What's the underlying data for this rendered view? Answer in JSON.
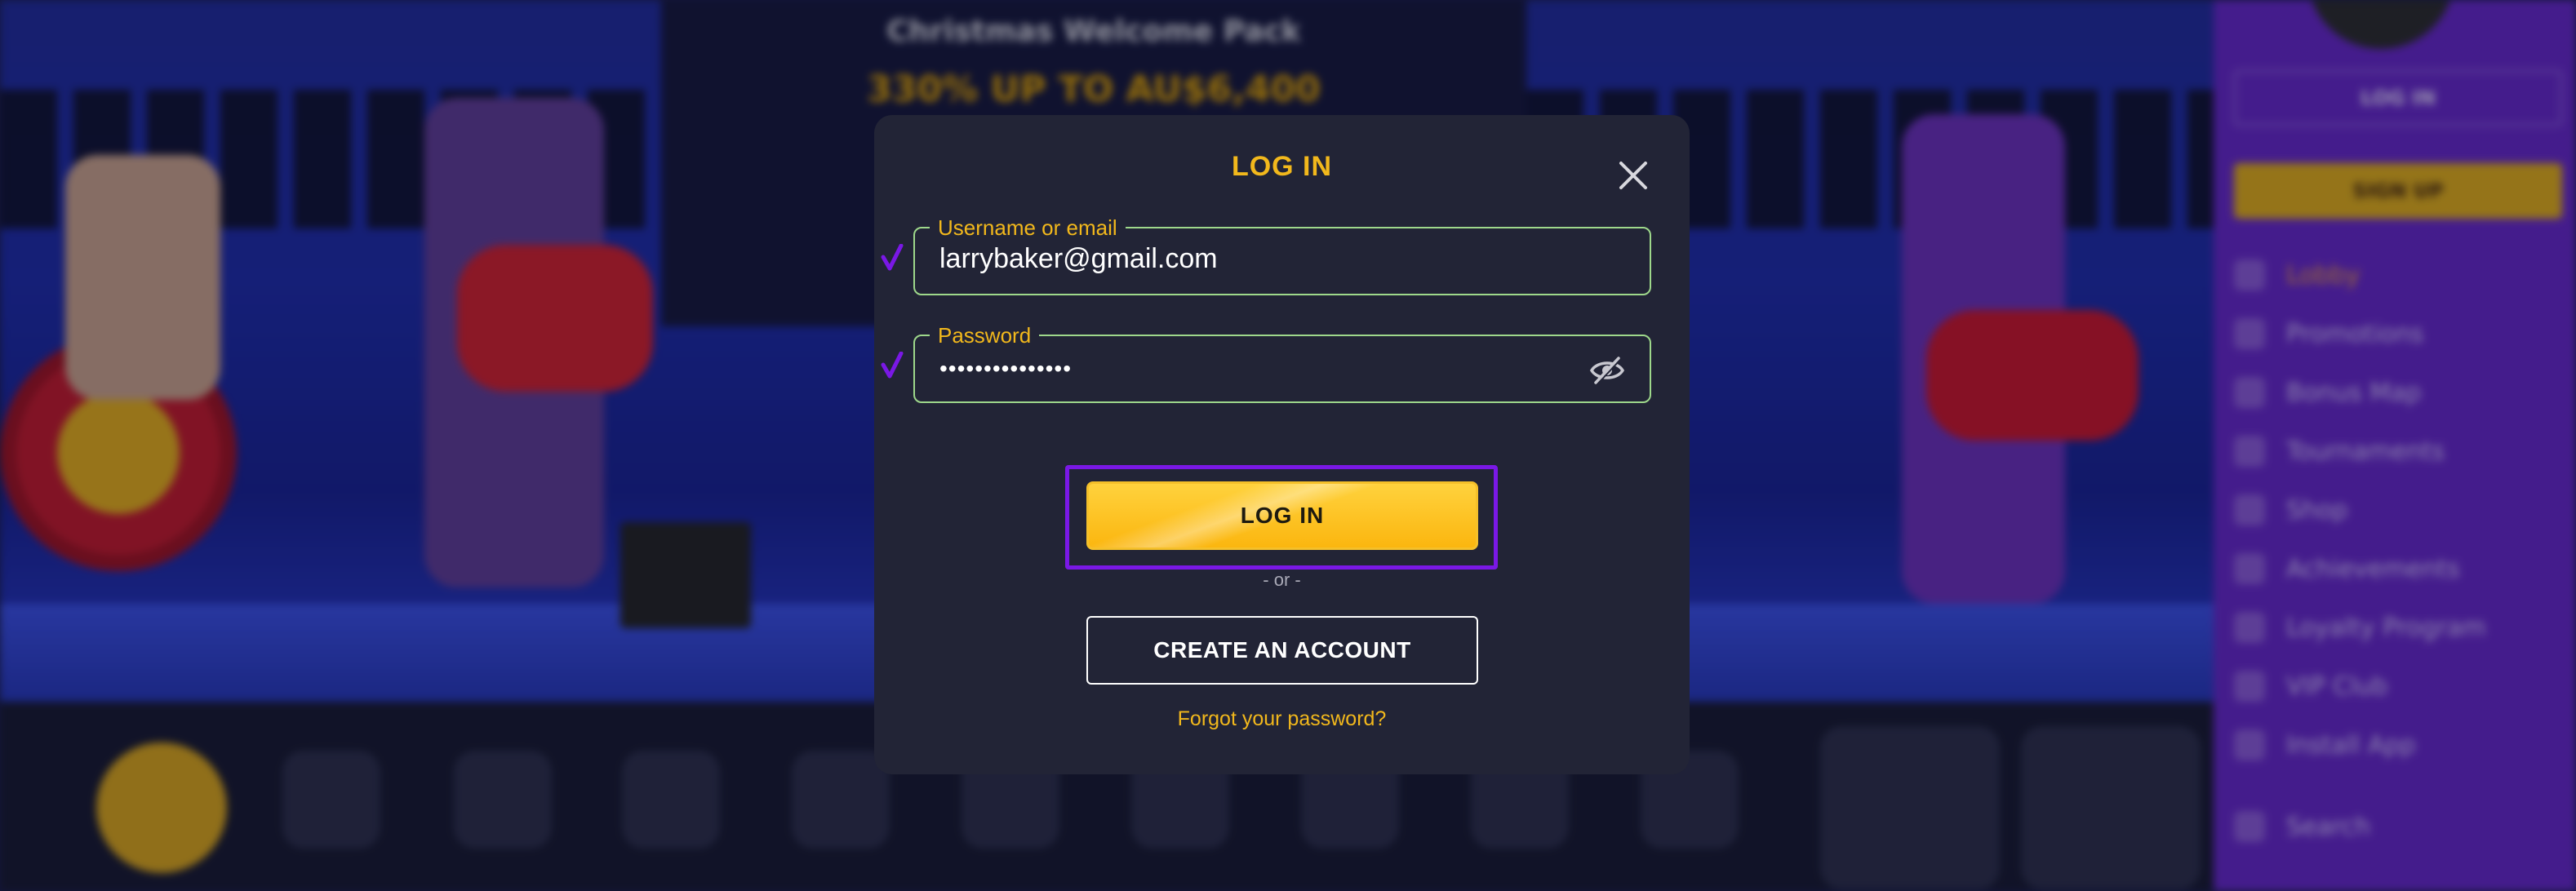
{
  "background": {
    "promo_title": "Christmas Welcome Pack",
    "promo_offer": "330% UP TO AU$6,400",
    "sidebar": {
      "login_label": "LOG IN",
      "signup_label": "SIGN UP",
      "items": [
        {
          "label": "Lobby",
          "icon": "lobby-icon"
        },
        {
          "label": "Promotions",
          "icon": "promotions-icon"
        },
        {
          "label": "Bonus Map",
          "icon": "map-icon"
        },
        {
          "label": "Tournaments",
          "icon": "trophy-icon"
        },
        {
          "label": "Shop",
          "icon": "shop-icon"
        },
        {
          "label": "Achievements",
          "icon": "achievements-icon"
        },
        {
          "label": "Loyalty Program",
          "icon": "star-icon"
        },
        {
          "label": "VIP Club",
          "icon": "crown-icon"
        },
        {
          "label": "Install App",
          "icon": "install-icon"
        },
        {
          "label": "Search",
          "icon": "search-icon"
        }
      ]
    }
  },
  "login_modal": {
    "title": "LOG IN",
    "username": {
      "label": "Username or email",
      "value": "larrybaker@gmail.com"
    },
    "password": {
      "label": "Password",
      "value": "•••••••••••••••"
    },
    "login_button": "LOG IN",
    "separator": "- or -",
    "create_account_button": "CREATE AN ACCOUNT",
    "forgot_password": "Forgot your password?"
  },
  "colors": {
    "accent_yellow": "#f2b81c",
    "modal_bg": "#222436",
    "field_valid_border": "#9ed88b",
    "check_purple": "#7a18e6",
    "sidebar_purple": "#6526c8"
  }
}
